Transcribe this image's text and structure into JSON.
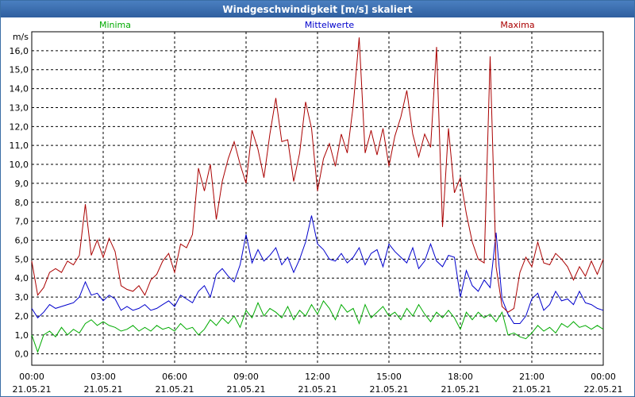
{
  "title": "Windgeschwindigkeit [m/s] skaliert",
  "colors": {
    "min": "#00aa00",
    "mean": "#0000cc",
    "max": "#aa0000",
    "grid": "#000000",
    "titlebar": "#3a6ea5"
  },
  "chart_data": {
    "type": "line",
    "ylabel": "m/s",
    "ylim": [
      -0.6,
      17.0
    ],
    "yticks": [
      "0,0",
      "1,0",
      "2,0",
      "3,0",
      "4,0",
      "5,0",
      "6,0",
      "7,0",
      "8,0",
      "9,0",
      "10,0",
      "11,0",
      "12,0",
      "13,0",
      "14,0",
      "15,0",
      "16,0"
    ],
    "xlim_hours": [
      0,
      24
    ],
    "xticks": [
      {
        "time": "00:00",
        "date": "21.05.21"
      },
      {
        "time": "03:00",
        "date": "21.05.21"
      },
      {
        "time": "06:00",
        "date": "21.05.21"
      },
      {
        "time": "09:00",
        "date": "21.05.21"
      },
      {
        "time": "12:00",
        "date": "21.05.21"
      },
      {
        "time": "15:00",
        "date": "21.05.21"
      },
      {
        "time": "18:00",
        "date": "21.05.21"
      },
      {
        "time": "21:00",
        "date": "21.05.21"
      },
      {
        "time": "00:00",
        "date": "22.05.21"
      }
    ],
    "grid": true,
    "legend_position": "top",
    "series": [
      {
        "name": "Minima",
        "key": "min",
        "x": [
          0,
          0.25,
          0.5,
          0.75,
          1,
          1.25,
          1.5,
          1.75,
          2,
          2.25,
          2.5,
          2.75,
          3,
          3.25,
          3.5,
          3.75,
          4,
          4.25,
          4.5,
          4.75,
          5,
          5.25,
          5.5,
          5.75,
          6,
          6.25,
          6.5,
          6.75,
          7,
          7.25,
          7.5,
          7.75,
          8,
          8.25,
          8.5,
          8.75,
          9,
          9.25,
          9.5,
          9.75,
          10,
          10.25,
          10.5,
          10.75,
          11,
          11.25,
          11.5,
          11.75,
          12,
          12.25,
          12.5,
          12.75,
          13,
          13.25,
          13.5,
          13.75,
          14,
          14.25,
          14.5,
          14.75,
          15,
          15.25,
          15.5,
          15.75,
          16,
          16.25,
          16.5,
          16.75,
          17,
          17.25,
          17.5,
          17.75,
          18,
          18.25,
          18.5,
          18.75,
          19,
          19.25,
          19.5,
          19.75,
          20,
          20.25,
          20.5,
          20.75,
          21,
          21.25,
          21.5,
          21.75,
          22,
          22.25,
          22.5,
          22.75,
          23,
          23.25,
          23.5,
          23.75,
          24
        ],
        "values": [
          1.0,
          0.1,
          1.0,
          1.2,
          0.9,
          1.4,
          1.0,
          1.3,
          1.1,
          1.6,
          1.8,
          1.5,
          1.7,
          1.5,
          1.4,
          1.2,
          1.3,
          1.5,
          1.2,
          1.4,
          1.2,
          1.5,
          1.3,
          1.4,
          1.2,
          1.6,
          1.3,
          1.4,
          1.0,
          1.3,
          1.8,
          1.5,
          1.9,
          1.6,
          2.0,
          1.4,
          2.3,
          1.9,
          2.7,
          2.0,
          2.4,
          2.2,
          1.9,
          2.5,
          1.8,
          2.3,
          2.0,
          2.6,
          2.1,
          2.8,
          2.4,
          1.8,
          2.6,
          2.2,
          2.4,
          1.6,
          2.6,
          1.9,
          2.2,
          2.5,
          2.0,
          2.2,
          1.8,
          2.4,
          2.0,
          2.6,
          2.1,
          1.7,
          2.2,
          1.9,
          2.3,
          1.9,
          1.3,
          2.2,
          1.8,
          2.2,
          1.9,
          2.1,
          1.7,
          2.2,
          1.0,
          1.1,
          0.9,
          0.8,
          1.1,
          1.5,
          1.2,
          1.4,
          1.1,
          1.6,
          1.4,
          1.7,
          1.4,
          1.5,
          1.3,
          1.5,
          1.3
        ]
      },
      {
        "name": "Mittelwerte",
        "key": "mean",
        "x": [
          0,
          0.25,
          0.5,
          0.75,
          1,
          1.25,
          1.5,
          1.75,
          2,
          2.25,
          2.5,
          2.75,
          3,
          3.25,
          3.5,
          3.75,
          4,
          4.25,
          4.5,
          4.75,
          5,
          5.25,
          5.5,
          5.75,
          6,
          6.25,
          6.5,
          6.75,
          7,
          7.25,
          7.5,
          7.75,
          8,
          8.25,
          8.5,
          8.75,
          9,
          9.25,
          9.5,
          9.75,
          10,
          10.25,
          10.5,
          10.75,
          11,
          11.25,
          11.5,
          11.75,
          12,
          12.25,
          12.5,
          12.75,
          13,
          13.25,
          13.5,
          13.75,
          14,
          14.25,
          14.5,
          14.75,
          15,
          15.25,
          15.5,
          15.75,
          16,
          16.25,
          16.5,
          16.75,
          17,
          17.25,
          17.5,
          17.75,
          18,
          18.25,
          18.5,
          18.75,
          19,
          19.25,
          19.5,
          19.75,
          20,
          20.25,
          20.5,
          20.75,
          21,
          21.25,
          21.5,
          21.75,
          22,
          22.25,
          22.5,
          22.75,
          23,
          23.25,
          23.5,
          23.75,
          24
        ],
        "values": [
          2.4,
          1.9,
          2.2,
          2.6,
          2.4,
          2.5,
          2.6,
          2.7,
          3.0,
          3.8,
          3.1,
          3.2,
          2.8,
          3.1,
          2.9,
          2.3,
          2.5,
          2.3,
          2.4,
          2.6,
          2.3,
          2.4,
          2.6,
          2.8,
          2.5,
          3.1,
          2.9,
          2.7,
          3.3,
          3.6,
          3.0,
          4.2,
          4.5,
          4.1,
          3.8,
          4.7,
          6.3,
          4.8,
          5.5,
          4.9,
          5.2,
          5.6,
          4.7,
          5.1,
          4.3,
          5.0,
          5.9,
          7.3,
          5.8,
          5.5,
          5.0,
          4.9,
          5.3,
          4.8,
          5.1,
          5.6,
          4.7,
          5.3,
          5.5,
          4.6,
          5.8,
          5.4,
          5.1,
          4.8,
          5.6,
          4.5,
          4.9,
          5.8,
          4.9,
          4.6,
          5.2,
          5.1,
          3.0,
          4.4,
          3.6,
          3.3,
          3.9,
          3.5,
          6.4,
          2.9,
          2.1,
          1.6,
          1.6,
          2.0,
          2.9,
          3.2,
          2.3,
          2.6,
          3.3,
          2.8,
          2.9,
          2.6,
          3.3,
          2.7,
          2.6,
          2.4,
          2.3
        ]
      },
      {
        "name": "Maxima",
        "key": "max",
        "x": [
          0,
          0.25,
          0.5,
          0.75,
          1,
          1.25,
          1.5,
          1.75,
          2,
          2.25,
          2.5,
          2.75,
          3,
          3.25,
          3.5,
          3.75,
          4,
          4.25,
          4.5,
          4.75,
          5,
          5.25,
          5.5,
          5.75,
          6,
          6.25,
          6.5,
          6.75,
          7,
          7.25,
          7.5,
          7.75,
          8,
          8.25,
          8.5,
          8.75,
          9,
          9.25,
          9.5,
          9.75,
          10,
          10.25,
          10.5,
          10.75,
          11,
          11.25,
          11.5,
          11.75,
          12,
          12.25,
          12.5,
          12.75,
          13,
          13.25,
          13.5,
          13.75,
          14,
          14.25,
          14.5,
          14.75,
          15,
          15.25,
          15.5,
          15.75,
          16,
          16.25,
          16.5,
          16.75,
          17,
          17.25,
          17.5,
          17.75,
          18,
          18.25,
          18.5,
          18.75,
          19,
          19.25,
          19.5,
          19.75,
          20,
          20.25,
          20.5,
          20.75,
          21,
          21.25,
          21.5,
          21.75,
          22,
          22.25,
          22.5,
          22.75,
          23,
          23.25,
          23.5,
          23.75,
          24
        ],
        "values": [
          4.9,
          3.1,
          3.5,
          4.3,
          4.5,
          4.3,
          4.9,
          4.7,
          5.2,
          7.9,
          5.2,
          6.0,
          5.1,
          6.1,
          5.4,
          3.6,
          3.4,
          3.3,
          3.6,
          3.1,
          3.9,
          4.2,
          4.9,
          5.3,
          4.3,
          5.8,
          5.6,
          6.3,
          9.8,
          8.6,
          10.0,
          7.1,
          9.1,
          10.3,
          11.2,
          10.0,
          9.0,
          11.8,
          10.8,
          9.3,
          11.6,
          13.5,
          11.2,
          11.3,
          9.1,
          10.6,
          13.3,
          11.9,
          8.6,
          10.3,
          11.1,
          9.9,
          11.6,
          10.6,
          13.1,
          16.7,
          10.6,
          11.8,
          10.5,
          11.9,
          9.9,
          11.5,
          12.5,
          13.9,
          11.6,
          10.4,
          11.6,
          10.9,
          16.2,
          6.7,
          11.9,
          8.5,
          9.3,
          7.4,
          5.9,
          5.0,
          4.8,
          15.7,
          4.6,
          2.5,
          2.2,
          2.4,
          4.3,
          5.1,
          4.6,
          5.9,
          4.8,
          4.7,
          5.3,
          5.0,
          4.6,
          3.9,
          4.6,
          4.1,
          4.9,
          4.2,
          5.0
        ]
      }
    ]
  }
}
